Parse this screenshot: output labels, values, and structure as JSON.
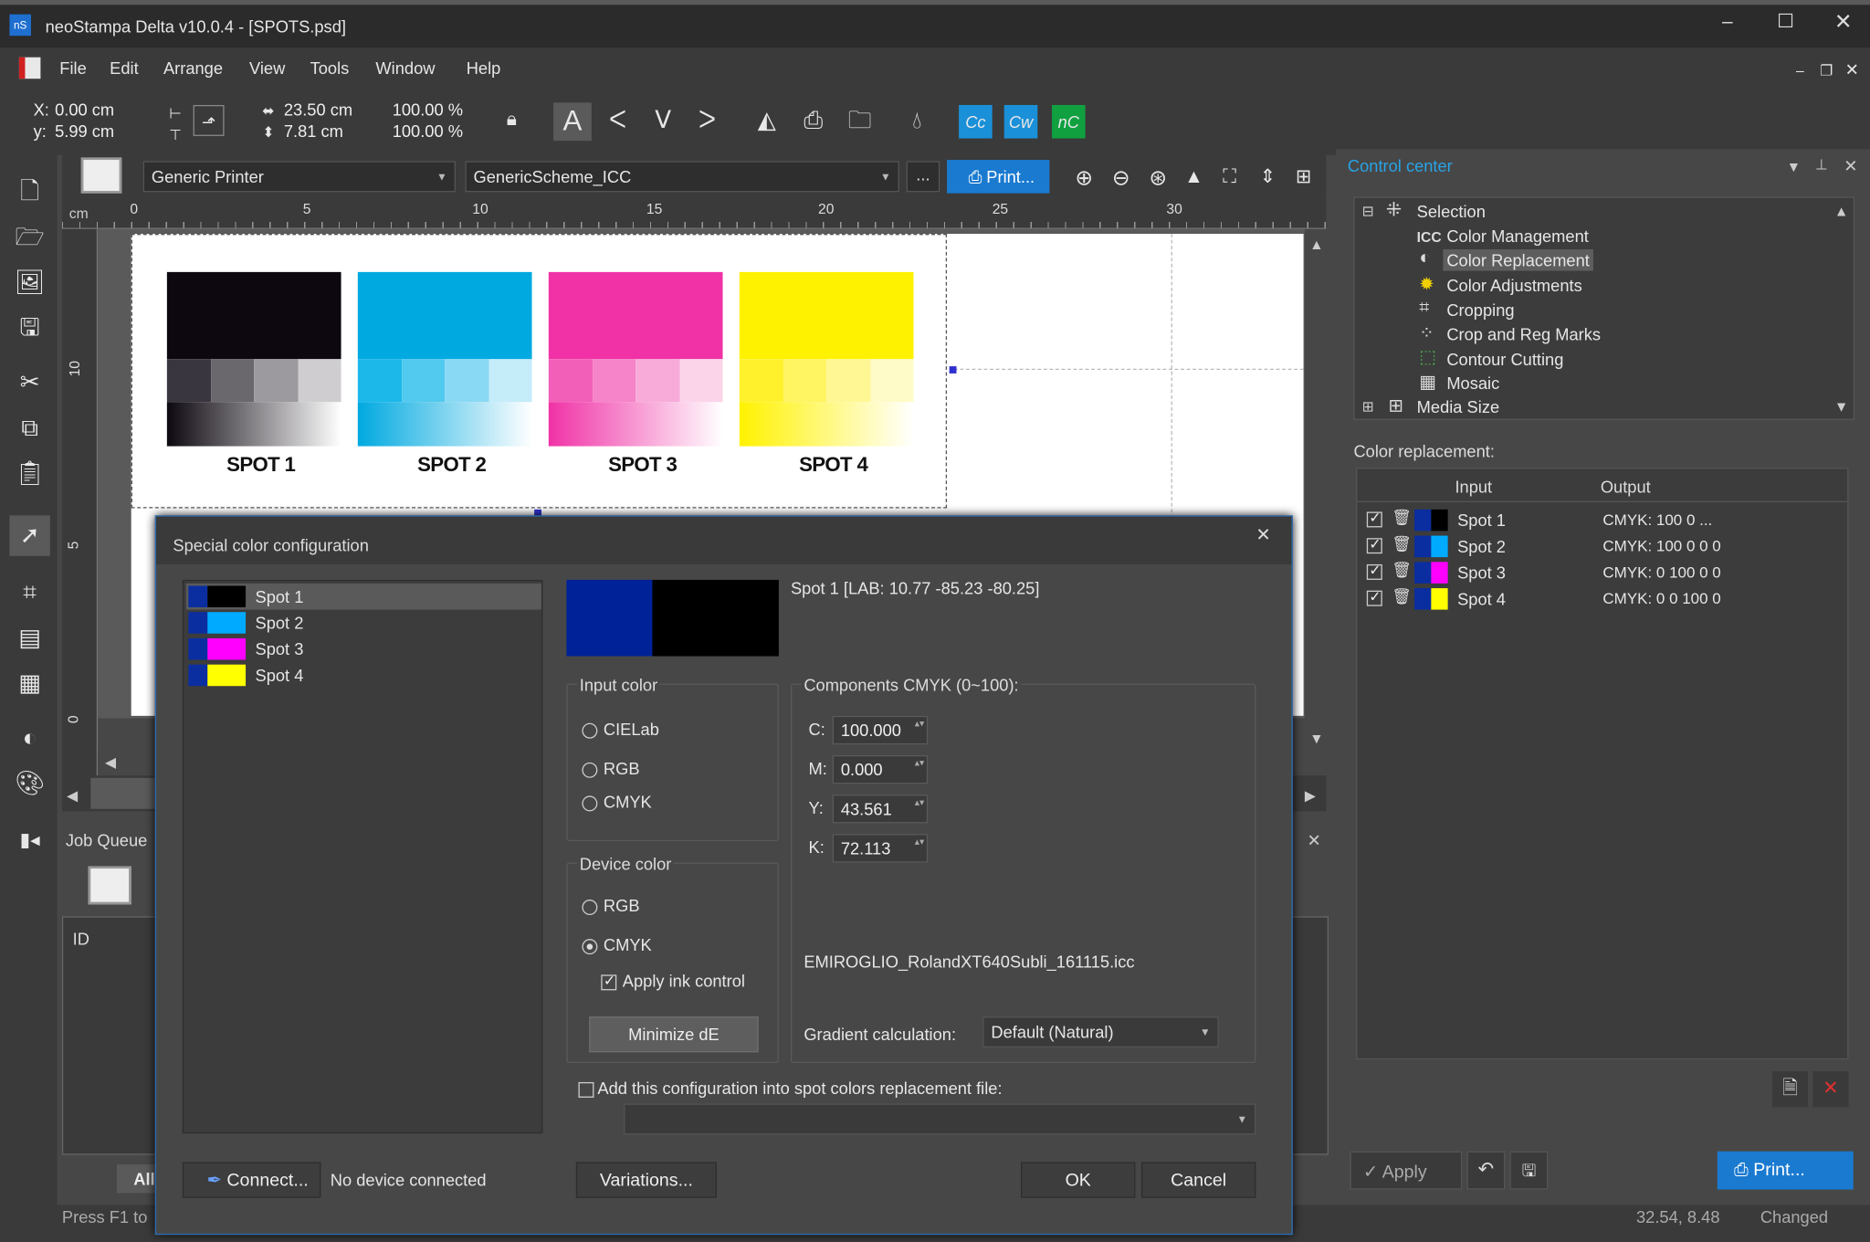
{
  "window": {
    "title": "neoStampa Delta  v10.0.4 - [SPOTS.psd]",
    "logo": "nS"
  },
  "menu": [
    "File",
    "Edit",
    "Arrange",
    "View",
    "Tools",
    "Window",
    "Help"
  ],
  "toolbar": {
    "x": "0.00 cm",
    "y": "5.99 cm",
    "x_label": "X:",
    "y_label": "y:",
    "width": "23.50 cm",
    "height": "7.81 cm",
    "scale_w": "100.00 %",
    "scale_h": "100.00 %",
    "cc_labels": [
      "Cc",
      "Cw",
      "nC"
    ]
  },
  "printer_bar": {
    "printer": "Generic Printer",
    "scheme": "GenericScheme_ICC",
    "more": "...",
    "print": "Print..."
  },
  "ruler": {
    "unit": "cm",
    "marks": [
      "0",
      "5",
      "10",
      "15",
      "20",
      "25",
      "30"
    ],
    "v_marks": [
      "10",
      "5",
      "0"
    ]
  },
  "spots": [
    {
      "label": "SPOT 1",
      "main": "#0d0810",
      "steps": [
        "#3a3640",
        "#6a686d",
        "#9c9a9e",
        "#cfcdd0"
      ]
    },
    {
      "label": "SPOT 2",
      "main": "#00a9e0",
      "steps": [
        "#1cb8ea",
        "#52c9ef",
        "#8ad9f4",
        "#c4ecf9"
      ]
    },
    {
      "label": "SPOT 3",
      "main": "#f032a6",
      "steps": [
        "#f25fb8",
        "#f584c8",
        "#f8abd9",
        "#fbd4ea"
      ]
    },
    {
      "label": "SPOT 4",
      "main": "#fff200",
      "steps": [
        "#fff22d",
        "#fff461",
        "#fff794",
        "#fffbc8"
      ]
    }
  ],
  "jobqueue": {
    "title": "Job Queue",
    "col_id": "ID",
    "tab_all": "All"
  },
  "control_center": {
    "title": "Control center",
    "tree": [
      {
        "label": "Selection",
        "icon": "selection-icon",
        "expanded": true
      },
      {
        "label": "Color Management",
        "icon": "icc-icon"
      },
      {
        "label": "Color Replacement",
        "icon": "color-replacement-icon",
        "selected": true
      },
      {
        "label": "Color Adjustments",
        "icon": "color-adjust-icon"
      },
      {
        "label": "Cropping",
        "icon": "crop-icon"
      },
      {
        "label": "Crop and Reg Marks",
        "icon": "reg-marks-icon"
      },
      {
        "label": "Contour Cutting",
        "icon": "contour-icon"
      },
      {
        "label": "Mosaic",
        "icon": "mosaic-icon"
      },
      {
        "label": "Media Size",
        "icon": "media-size-icon"
      }
    ],
    "icc_tag": "ICC",
    "replacement_title": "Color replacement:",
    "col_input": "Input",
    "col_output": "Output",
    "rows": [
      {
        "name": "Spot 1",
        "output": "CMYK:  100 0 ...",
        "color": "#000000"
      },
      {
        "name": "Spot 2",
        "output": "CMYK:  100 0 0 0",
        "color": "#00aaff"
      },
      {
        "name": "Spot 3",
        "output": "CMYK:  0 100 0 0",
        "color": "#ff00ff"
      },
      {
        "name": "Spot 4",
        "output": "CMYK:  0 0 100 0",
        "color": "#ffff00"
      }
    ],
    "apply": "Apply",
    "print": "Print..."
  },
  "dialog": {
    "title": "Special color configuration",
    "list": [
      "Spot 1",
      "Spot 2",
      "Spot 3",
      "Spot 4"
    ],
    "list_colors": [
      "#000000",
      "#00aaff",
      "#ff00ff",
      "#ffff00"
    ],
    "preview_input": "#002299",
    "preview_output": "#000000",
    "spot_info": "Spot 1  [LAB: 10.77 -85.23 -80.25]",
    "input_color": {
      "title": "Input color",
      "options": [
        "CIELab",
        "RGB",
        "CMYK"
      ]
    },
    "device_color": {
      "title": "Device color",
      "options": [
        "RGB",
        "CMYK"
      ],
      "selected": "CMYK",
      "ink_control": "Apply ink control",
      "minimize": "Minimize dE"
    },
    "components": {
      "title": "Components CMYK (0~100):",
      "C": "100.000",
      "M": "0.000",
      "Y": "43.561",
      "K": "72.113",
      "c_label": "C:",
      "m_label": "M:",
      "y_label": "Y:",
      "k_label": "K:"
    },
    "profile": "EMIROGLIO_RolandXT640Subli_161115.icc",
    "gradient_label": "Gradient calculation:",
    "gradient_value": "Default (Natural)",
    "add_config": "Add this configuration into spot colors replacement file:",
    "connect": "Connect...",
    "no_device": "No device connected",
    "variations": "Variations...",
    "ok": "OK",
    "cancel": "Cancel"
  },
  "status": {
    "help": "Press F1 to",
    "coords": "32.54, 8.48",
    "state": "Changed"
  }
}
